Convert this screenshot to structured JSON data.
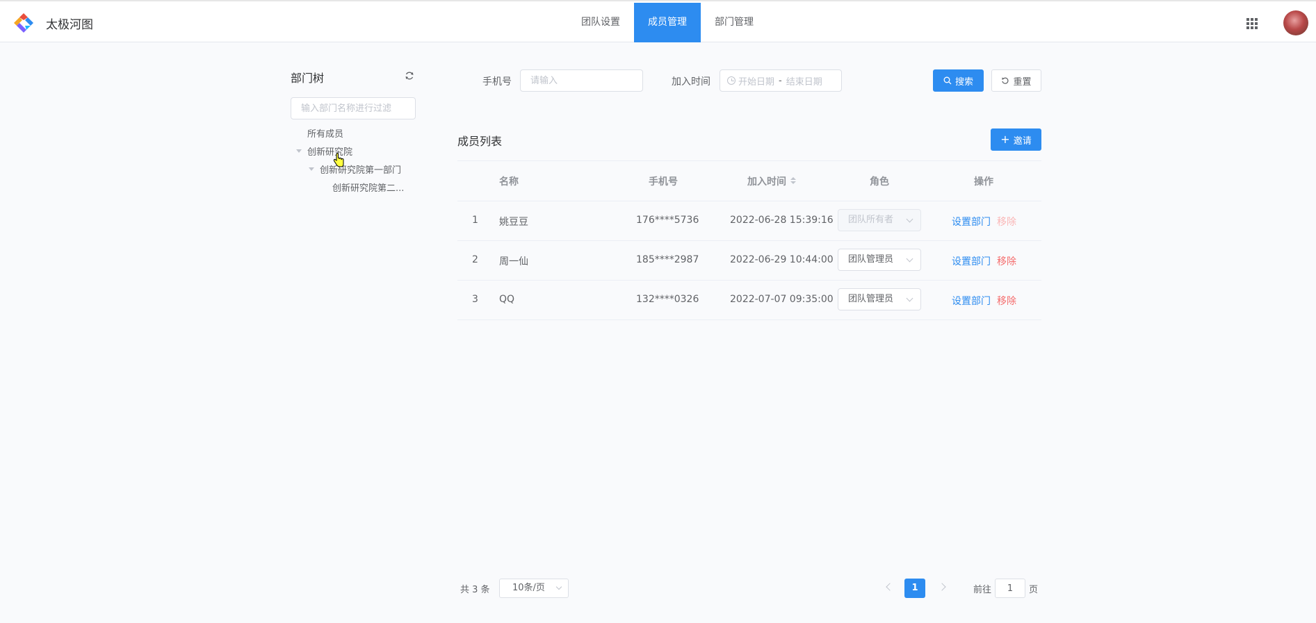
{
  "app": {
    "title": "太极河图"
  },
  "nav": {
    "tabs": [
      {
        "label": "团队设置"
      },
      {
        "label": "成员管理"
      },
      {
        "label": "部门管理"
      }
    ]
  },
  "tree": {
    "title": "部门树",
    "filter_placeholder": "输入部门名称进行过滤",
    "nodes": [
      {
        "label": "所有成员"
      },
      {
        "label": "创新研究院"
      },
      {
        "label": "创新研究院第一部门"
      },
      {
        "label": "创新研究院第二..."
      }
    ]
  },
  "search": {
    "phone_label": "手机号",
    "phone_placeholder": "请输入",
    "join_label": "加入时间",
    "start_placeholder": "开始日期",
    "separator": "-",
    "end_placeholder": "结束日期",
    "search_button": "搜索",
    "reset_button": "重置"
  },
  "list": {
    "title": "成员列表",
    "invite_button": "邀请",
    "columns": [
      "名称",
      "手机号",
      "加入时间",
      "角色",
      "操作"
    ],
    "rows": [
      {
        "index": "1",
        "name": "姚豆豆",
        "phone": "176****5736",
        "joined": "2022-06-28 15:39:16",
        "role": "团队所有者",
        "action_dept": "设置部门",
        "action_remove": "移除"
      },
      {
        "index": "2",
        "name": "周一仙",
        "phone": "185****2987",
        "joined": "2022-06-29 10:44:00",
        "role": "团队管理员",
        "action_dept": "设置部门",
        "action_remove": "移除"
      },
      {
        "index": "3",
        "name": "QQ",
        "phone": "132****0326",
        "joined": "2022-07-07 09:35:00",
        "role": "团队管理员",
        "action_dept": "设置部门",
        "action_remove": "移除"
      }
    ]
  },
  "pagination": {
    "total_text": "共 3 条",
    "page_size": "10条/页",
    "current_page": "1",
    "goto_label": "前往",
    "goto_value": "1",
    "goto_unit": "页"
  },
  "colors": {
    "primary": "#2d8cf0",
    "danger": "#f56c6c"
  }
}
